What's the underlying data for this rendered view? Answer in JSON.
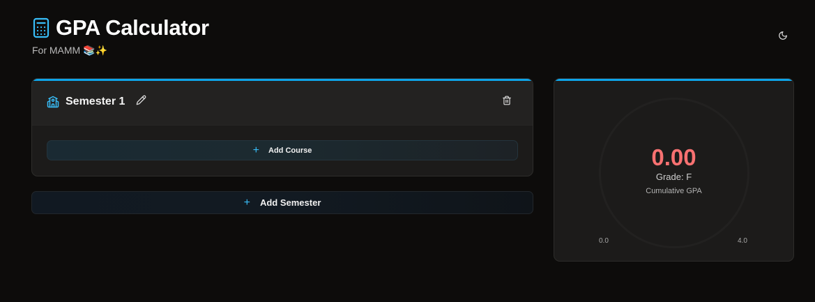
{
  "header": {
    "title": "GPA Calculator",
    "subtitle": "For MAMM 📚✨",
    "title_icon": "calculator-icon",
    "theme_toggle_icon": "moon-icon"
  },
  "semesters": [
    {
      "name": "Semester 1",
      "icon": "school-building-icon",
      "edit_icon": "pencil-icon",
      "delete_icon": "trash-icon",
      "add_course_label": "Add Course"
    }
  ],
  "add_semester_label": "Add Semester",
  "gpa": {
    "value": "0.00",
    "grade": "Grade: F",
    "caption": "Cumulative GPA",
    "scale_min": "0.0",
    "scale_max": "4.0",
    "fraction": 0
  },
  "colors": {
    "accent": "#0ea5e9",
    "gpa_value": "#f87171",
    "background": "#0d0c0b"
  }
}
